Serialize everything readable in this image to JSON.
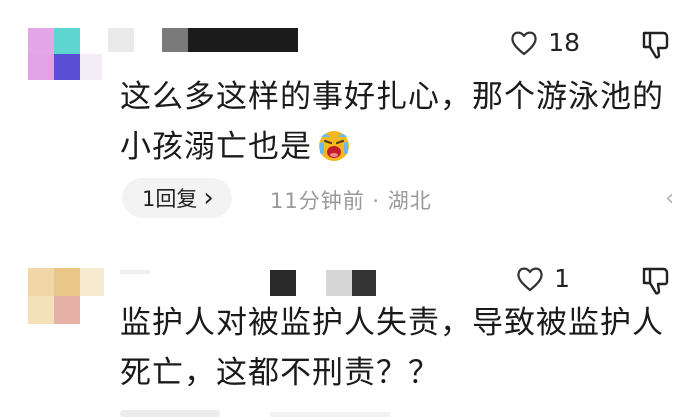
{
  "comments": [
    {
      "likes": "18",
      "text_line1": "这么多这样的事好扎心，那个游泳池的",
      "text_line2": "小孩溺亡也是",
      "emoji": "crying-face",
      "reply_label": "1回复",
      "reply_chevron": "›",
      "time_location": "11分钟前 · 湖北",
      "more_label": "‹"
    },
    {
      "likes": "1",
      "text_line1": "监护人对被监护人失责，导致被监护人",
      "text_line2": "死亡，这都不刑责？？"
    }
  ],
  "colors": {
    "avatar1": [
      "#e6a6e8",
      "#62d6d0",
      "#5a4fd4",
      "#f2ecf4"
    ],
    "avatar2": [
      "#f1d7a9",
      "#e8c78c",
      "#f6ebd1",
      "#e7b2a8"
    ],
    "meta": "#9a9a9a",
    "pill": "#f3f3f3"
  },
  "icons": [
    "heart-outline-icon",
    "thumb-down-icon",
    "chevron-right-icon",
    "crying-emoji-icon"
  ]
}
